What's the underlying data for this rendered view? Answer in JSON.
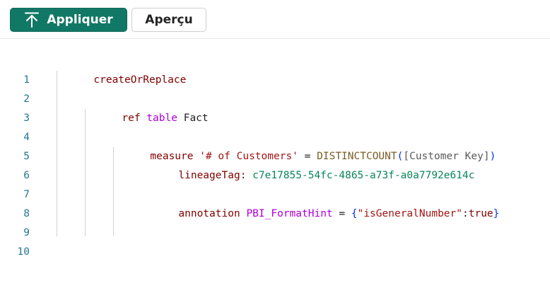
{
  "toolbar": {
    "apply_label": "Appliquer",
    "preview_label": "Aperçu",
    "apply_icon": "upload-arrow-icon",
    "accent_color": "#117865"
  },
  "editor": {
    "line_numbers": [
      "1",
      "2",
      "3",
      "4",
      "5",
      "6",
      "7",
      "8",
      "9",
      "10"
    ],
    "tokens": {
      "l1_keyword": "createOrReplace",
      "l3_ref": "ref",
      "l3_table": "table",
      "l3_name": "Fact",
      "l5_measure": "measure",
      "l5_name": "'# of Customers'",
      "l5_eq": "=",
      "l5_func": "DISTINCTCOUNT",
      "l5_open": "(",
      "l5_col": "[Customer Key]",
      "l5_close": ")",
      "l6_prop": "lineageTag:",
      "l6_value": "c7e17855-54fc-4865-a73f-a0a7792e614c",
      "l8_keyword": "annotation",
      "l8_name": "PBI_FormatHint",
      "l8_eq": "=",
      "l8_open": "{",
      "l8_key": "\"isGeneralNumber\"",
      "l8_colon": ":",
      "l8_val": "true",
      "l8_close": "}"
    }
  }
}
